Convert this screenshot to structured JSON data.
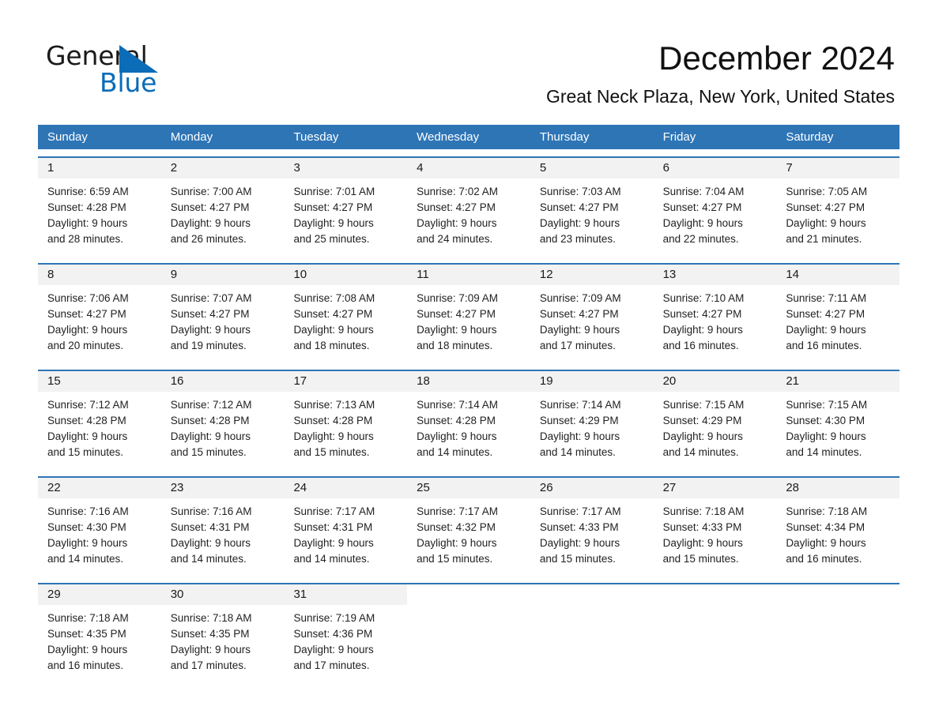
{
  "brand": {
    "name_part1": "General",
    "name_part2": "Blue",
    "triangle_icon": "blue-triangle-icon",
    "accent_color": "#0b6cb8"
  },
  "header": {
    "month_title": "December 2024",
    "location": "Great Neck Plaza, New York, United States"
  },
  "calendar": {
    "header_bg": "#2e75b6",
    "daynum_band_bg": "#f2f2f2",
    "weekday_headers": [
      "Sunday",
      "Monday",
      "Tuesday",
      "Wednesday",
      "Thursday",
      "Friday",
      "Saturday"
    ],
    "weeks": [
      [
        {
          "day": "1",
          "sunrise": "Sunrise: 6:59 AM",
          "sunset": "Sunset: 4:28 PM",
          "daylight_line1": "Daylight: 9 hours",
          "daylight_line2": "and 28 minutes."
        },
        {
          "day": "2",
          "sunrise": "Sunrise: 7:00 AM",
          "sunset": "Sunset: 4:27 PM",
          "daylight_line1": "Daylight: 9 hours",
          "daylight_line2": "and 26 minutes."
        },
        {
          "day": "3",
          "sunrise": "Sunrise: 7:01 AM",
          "sunset": "Sunset: 4:27 PM",
          "daylight_line1": "Daylight: 9 hours",
          "daylight_line2": "and 25 minutes."
        },
        {
          "day": "4",
          "sunrise": "Sunrise: 7:02 AM",
          "sunset": "Sunset: 4:27 PM",
          "daylight_line1": "Daylight: 9 hours",
          "daylight_line2": "and 24 minutes."
        },
        {
          "day": "5",
          "sunrise": "Sunrise: 7:03 AM",
          "sunset": "Sunset: 4:27 PM",
          "daylight_line1": "Daylight: 9 hours",
          "daylight_line2": "and 23 minutes."
        },
        {
          "day": "6",
          "sunrise": "Sunrise: 7:04 AM",
          "sunset": "Sunset: 4:27 PM",
          "daylight_line1": "Daylight: 9 hours",
          "daylight_line2": "and 22 minutes."
        },
        {
          "day": "7",
          "sunrise": "Sunrise: 7:05 AM",
          "sunset": "Sunset: 4:27 PM",
          "daylight_line1": "Daylight: 9 hours",
          "daylight_line2": "and 21 minutes."
        }
      ],
      [
        {
          "day": "8",
          "sunrise": "Sunrise: 7:06 AM",
          "sunset": "Sunset: 4:27 PM",
          "daylight_line1": "Daylight: 9 hours",
          "daylight_line2": "and 20 minutes."
        },
        {
          "day": "9",
          "sunrise": "Sunrise: 7:07 AM",
          "sunset": "Sunset: 4:27 PM",
          "daylight_line1": "Daylight: 9 hours",
          "daylight_line2": "and 19 minutes."
        },
        {
          "day": "10",
          "sunrise": "Sunrise: 7:08 AM",
          "sunset": "Sunset: 4:27 PM",
          "daylight_line1": "Daylight: 9 hours",
          "daylight_line2": "and 18 minutes."
        },
        {
          "day": "11",
          "sunrise": "Sunrise: 7:09 AM",
          "sunset": "Sunset: 4:27 PM",
          "daylight_line1": "Daylight: 9 hours",
          "daylight_line2": "and 18 minutes."
        },
        {
          "day": "12",
          "sunrise": "Sunrise: 7:09 AM",
          "sunset": "Sunset: 4:27 PM",
          "daylight_line1": "Daylight: 9 hours",
          "daylight_line2": "and 17 minutes."
        },
        {
          "day": "13",
          "sunrise": "Sunrise: 7:10 AM",
          "sunset": "Sunset: 4:27 PM",
          "daylight_line1": "Daylight: 9 hours",
          "daylight_line2": "and 16 minutes."
        },
        {
          "day": "14",
          "sunrise": "Sunrise: 7:11 AM",
          "sunset": "Sunset: 4:27 PM",
          "daylight_line1": "Daylight: 9 hours",
          "daylight_line2": "and 16 minutes."
        }
      ],
      [
        {
          "day": "15",
          "sunrise": "Sunrise: 7:12 AM",
          "sunset": "Sunset: 4:28 PM",
          "daylight_line1": "Daylight: 9 hours",
          "daylight_line2": "and 15 minutes."
        },
        {
          "day": "16",
          "sunrise": "Sunrise: 7:12 AM",
          "sunset": "Sunset: 4:28 PM",
          "daylight_line1": "Daylight: 9 hours",
          "daylight_line2": "and 15 minutes."
        },
        {
          "day": "17",
          "sunrise": "Sunrise: 7:13 AM",
          "sunset": "Sunset: 4:28 PM",
          "daylight_line1": "Daylight: 9 hours",
          "daylight_line2": "and 15 minutes."
        },
        {
          "day": "18",
          "sunrise": "Sunrise: 7:14 AM",
          "sunset": "Sunset: 4:28 PM",
          "daylight_line1": "Daylight: 9 hours",
          "daylight_line2": "and 14 minutes."
        },
        {
          "day": "19",
          "sunrise": "Sunrise: 7:14 AM",
          "sunset": "Sunset: 4:29 PM",
          "daylight_line1": "Daylight: 9 hours",
          "daylight_line2": "and 14 minutes."
        },
        {
          "day": "20",
          "sunrise": "Sunrise: 7:15 AM",
          "sunset": "Sunset: 4:29 PM",
          "daylight_line1": "Daylight: 9 hours",
          "daylight_line2": "and 14 minutes."
        },
        {
          "day": "21",
          "sunrise": "Sunrise: 7:15 AM",
          "sunset": "Sunset: 4:30 PM",
          "daylight_line1": "Daylight: 9 hours",
          "daylight_line2": "and 14 minutes."
        }
      ],
      [
        {
          "day": "22",
          "sunrise": "Sunrise: 7:16 AM",
          "sunset": "Sunset: 4:30 PM",
          "daylight_line1": "Daylight: 9 hours",
          "daylight_line2": "and 14 minutes."
        },
        {
          "day": "23",
          "sunrise": "Sunrise: 7:16 AM",
          "sunset": "Sunset: 4:31 PM",
          "daylight_line1": "Daylight: 9 hours",
          "daylight_line2": "and 14 minutes."
        },
        {
          "day": "24",
          "sunrise": "Sunrise: 7:17 AM",
          "sunset": "Sunset: 4:31 PM",
          "daylight_line1": "Daylight: 9 hours",
          "daylight_line2": "and 14 minutes."
        },
        {
          "day": "25",
          "sunrise": "Sunrise: 7:17 AM",
          "sunset": "Sunset: 4:32 PM",
          "daylight_line1": "Daylight: 9 hours",
          "daylight_line2": "and 15 minutes."
        },
        {
          "day": "26",
          "sunrise": "Sunrise: 7:17 AM",
          "sunset": "Sunset: 4:33 PM",
          "daylight_line1": "Daylight: 9 hours",
          "daylight_line2": "and 15 minutes."
        },
        {
          "day": "27",
          "sunrise": "Sunrise: 7:18 AM",
          "sunset": "Sunset: 4:33 PM",
          "daylight_line1": "Daylight: 9 hours",
          "daylight_line2": "and 15 minutes."
        },
        {
          "day": "28",
          "sunrise": "Sunrise: 7:18 AM",
          "sunset": "Sunset: 4:34 PM",
          "daylight_line1": "Daylight: 9 hours",
          "daylight_line2": "and 16 minutes."
        }
      ],
      [
        {
          "day": "29",
          "sunrise": "Sunrise: 7:18 AM",
          "sunset": "Sunset: 4:35 PM",
          "daylight_line1": "Daylight: 9 hours",
          "daylight_line2": "and 16 minutes."
        },
        {
          "day": "30",
          "sunrise": "Sunrise: 7:18 AM",
          "sunset": "Sunset: 4:35 PM",
          "daylight_line1": "Daylight: 9 hours",
          "daylight_line2": "and 17 minutes."
        },
        {
          "day": "31",
          "sunrise": "Sunrise: 7:19 AM",
          "sunset": "Sunset: 4:36 PM",
          "daylight_line1": "Daylight: 9 hours",
          "daylight_line2": "and 17 minutes."
        },
        {
          "day": "",
          "sunrise": "",
          "sunset": "",
          "daylight_line1": "",
          "daylight_line2": ""
        },
        {
          "day": "",
          "sunrise": "",
          "sunset": "",
          "daylight_line1": "",
          "daylight_line2": ""
        },
        {
          "day": "",
          "sunrise": "",
          "sunset": "",
          "daylight_line1": "",
          "daylight_line2": ""
        },
        {
          "day": "",
          "sunrise": "",
          "sunset": "",
          "daylight_line1": "",
          "daylight_line2": ""
        }
      ]
    ]
  }
}
